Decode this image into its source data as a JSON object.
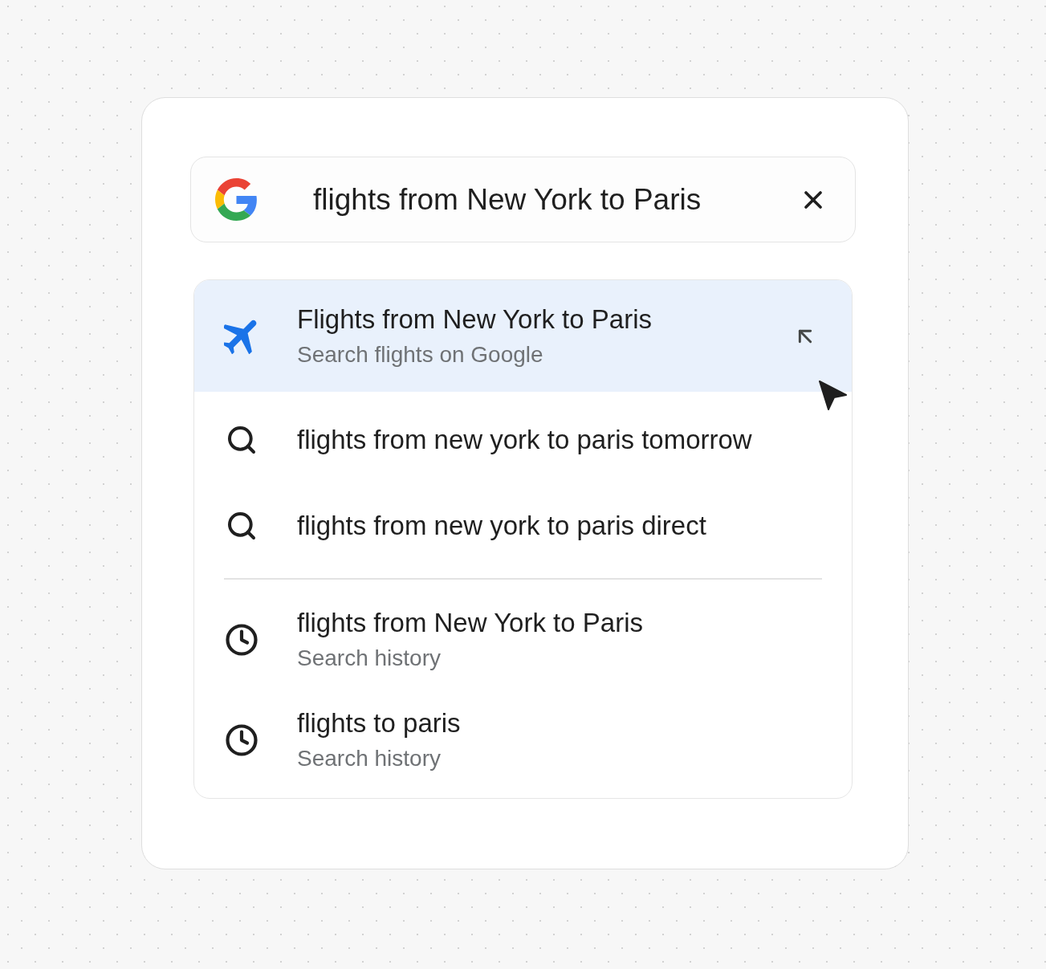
{
  "search": {
    "query": "flights from New York to Paris"
  },
  "suggestions": {
    "sections": [
      {
        "items": [
          {
            "kind": "flight",
            "title": "Flights from New York to Paris",
            "subtitle": "Search flights on Google",
            "selected": true
          },
          {
            "kind": "query",
            "title": "flights from new york to paris tomorrow",
            "selected": false
          },
          {
            "kind": "query",
            "title": "flights from new york to paris direct",
            "selected": false
          }
        ]
      },
      {
        "items": [
          {
            "kind": "history",
            "title": "flights from New York to Paris",
            "subtitle": "Search history",
            "selected": false
          },
          {
            "kind": "history",
            "title": "flights to paris",
            "subtitle": "Search history",
            "selected": false
          }
        ]
      }
    ]
  }
}
